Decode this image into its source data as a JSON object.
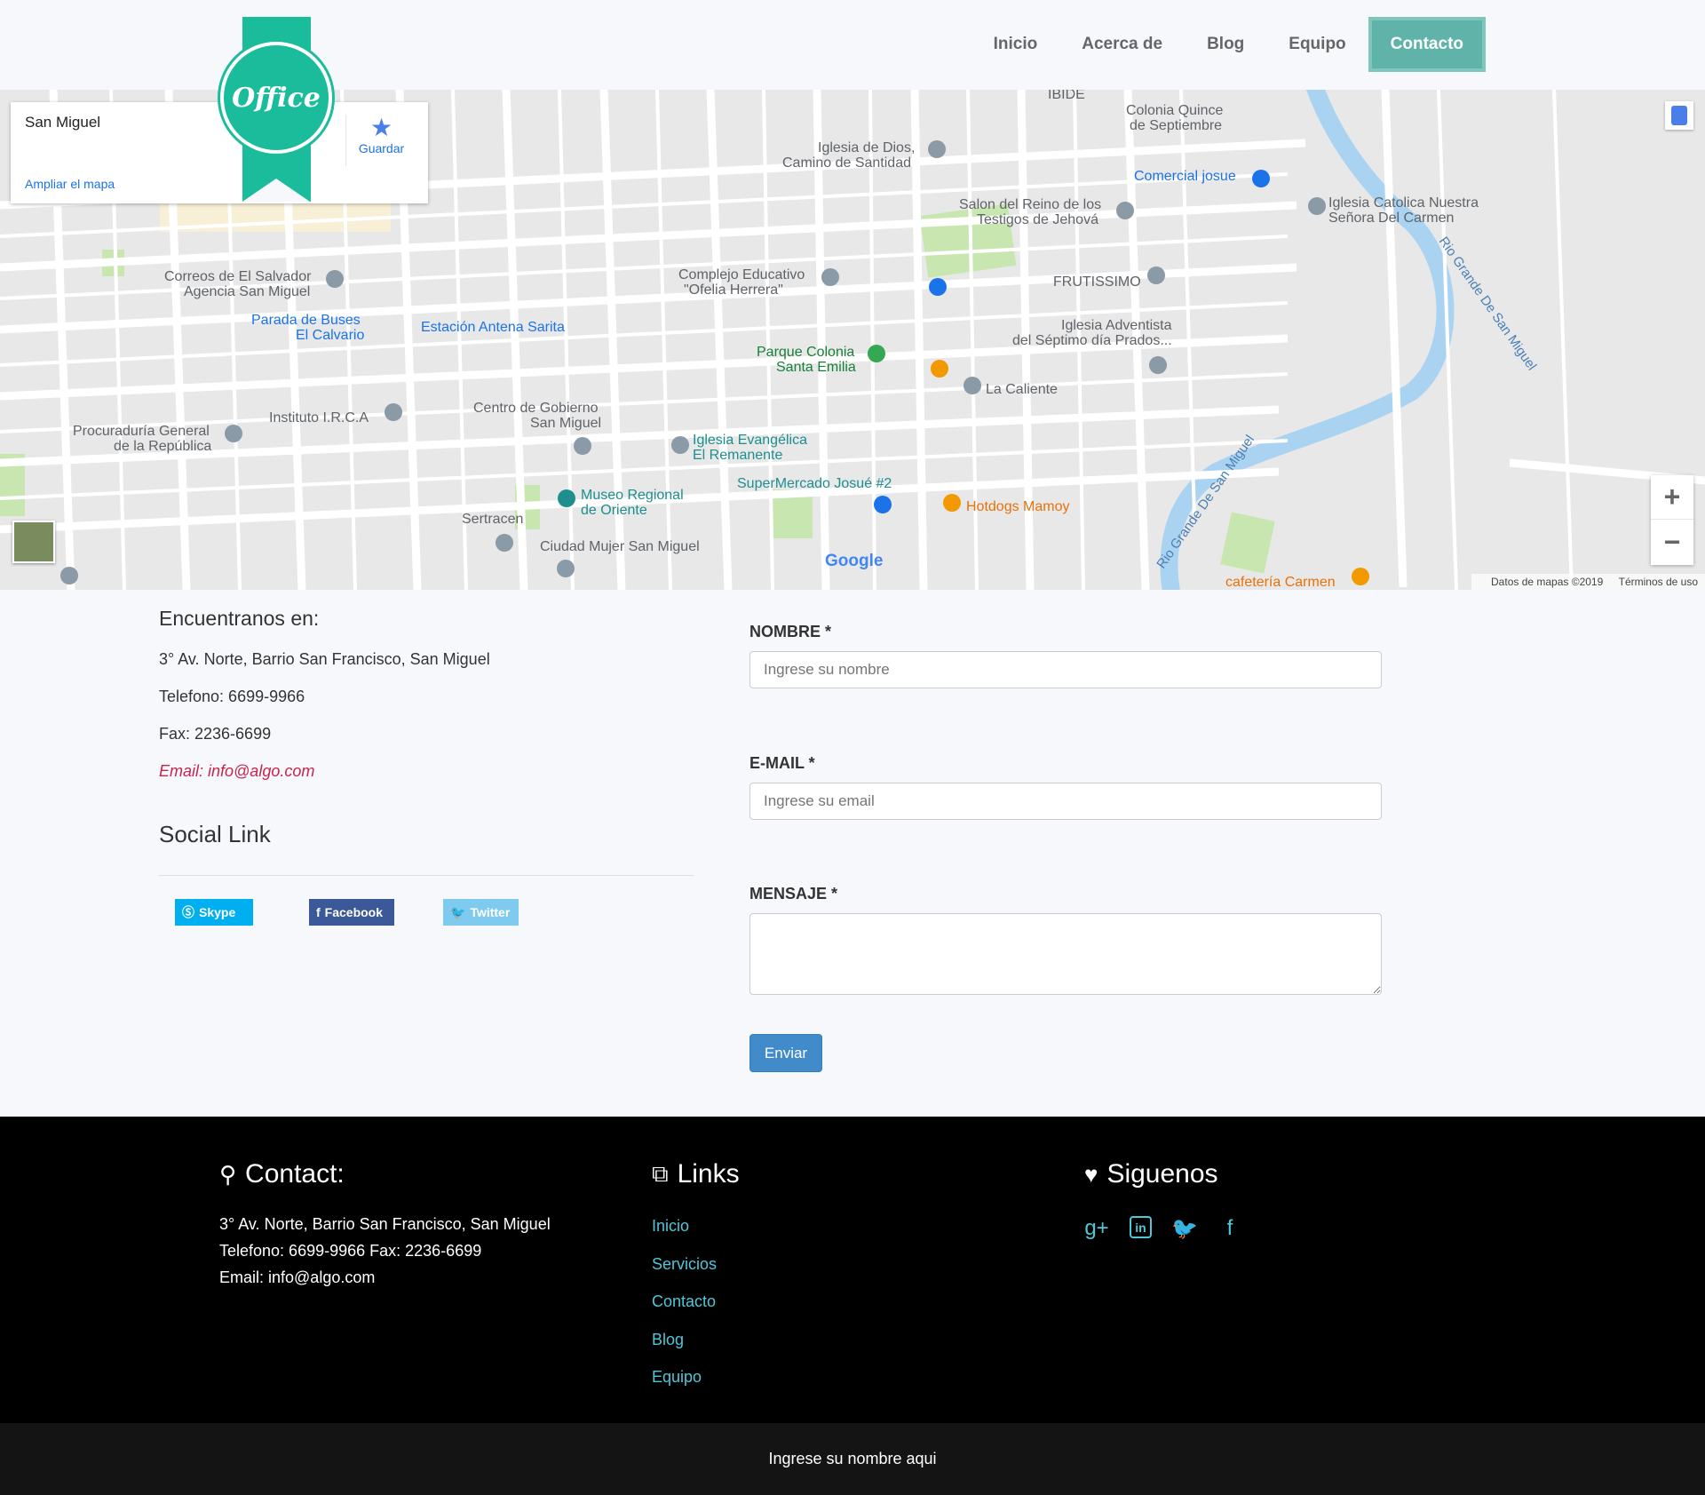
{
  "nav": {
    "items": [
      {
        "label": "Inicio"
      },
      {
        "label": "Acerca de"
      },
      {
        "label": "Blog"
      },
      {
        "label": "Equipo"
      },
      {
        "label": "Contacto",
        "active": true
      }
    ]
  },
  "logo": {
    "text": "Office",
    "color": "#1bbc9b"
  },
  "map": {
    "place_name": "San Miguel",
    "enlarge_link": "Ampliar el mapa",
    "save_label": "Guardar",
    "zoom_in": "+",
    "zoom_out": "−",
    "footer_data": "Datos de mapas ©2019",
    "footer_terms": "Términos de uso",
    "google_label": "Google",
    "labels": [
      "IBIDE",
      "Colonia Quince de Septiembre",
      "Iglesia de Dios, Camino de Santidad",
      "Comercial josue",
      "Salon del Reino de los Testigos de Jehová",
      "Iglesia Catolica Nuestra Señora Del Carmen",
      "Complejo Educativo \"Ofelia Herrera\"",
      "FRUTISSIMO",
      "Correos de El Salvador Agencia San Miguel",
      "Parada de Buses El Calvario",
      "Estación Antena Sarita",
      "Iglesia Adventista del Séptimo día Prados...",
      "Parque Colonia Santa Emilia",
      "La Caliente",
      "Procuraduría General de la República",
      "Instituto I.R.C.A",
      "Centro de Gobierno San Miguel",
      "Iglesia Evangélica El Remanente",
      "SuperMercado Josué #2",
      "Hotdogs Mamoy",
      "Museo Regional de Oriente",
      "Sertracen",
      "Ciudad Mujer San Miguel",
      "cafetería Carmen",
      "Rio Grande De San Miguel"
    ]
  },
  "info": {
    "heading": "Encuentranos en:",
    "address": "3° Av. Norte, Barrio San Francisco, San Miguel",
    "phone": "Telefono: 6699-9966",
    "fax": "Fax: 2236-6699",
    "email": "Email: info@algo.com",
    "social_heading": "Social Link",
    "social": {
      "skype": "Skype",
      "facebook": "Facebook",
      "twitter": "Twitter"
    }
  },
  "form": {
    "name_label": "NOMBRE *",
    "name_placeholder": "Ingrese su nombre",
    "email_label": "E-MAIL *",
    "email_placeholder": "Ingrese su email",
    "message_label": "MENSAJE *",
    "submit": "Enviar"
  },
  "footer": {
    "contact_title": "Contact:",
    "contact_line1": "3° Av. Norte, Barrio San Francisco, San Miguel",
    "contact_line2": "Telefono: 6699-9966 Fax: 2236-6699",
    "contact_line3": "Email: info@algo.com",
    "links_title": "Links",
    "links": [
      "Inicio",
      "Servicios",
      "Contacto",
      "Blog",
      "Equipo"
    ],
    "follow_title": "Siguenos",
    "follow_icons": [
      "google-plus-icon",
      "linkedin-icon",
      "twitter-icon",
      "facebook-icon"
    ],
    "bottom_text": "Ingrese su nombre aqui"
  },
  "colors": {
    "accent": "#5fb3a9",
    "link": "#4ec7d8",
    "button": "#428bca",
    "email": "#c7254e"
  }
}
